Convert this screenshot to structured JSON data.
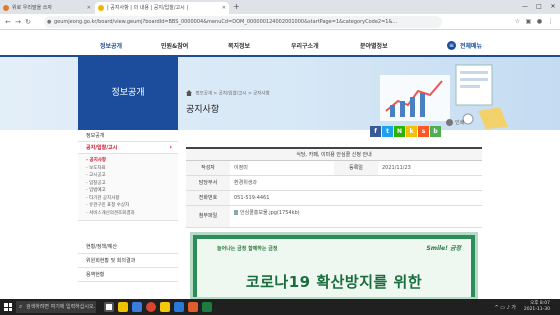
{
  "browser": {
    "tabs": [
      {
        "title": "위로 우리말을 쓰자"
      },
      {
        "title": "| 공지사항 | 의 내용 | 공지/입찰/고시 |"
      }
    ],
    "new_tab": "+",
    "window_controls": [
      "—",
      "□",
      "✕"
    ],
    "url": "geumjeong.go.kr/board/view.geumj?boardId=BBS_0000004&menuCd=DOM_000000124002001000&startPage=1&categoryCode2=1&..."
  },
  "site": {
    "gnb": [
      "정보공개",
      "민원&참여",
      "복지정보",
      "우리구소개",
      "분야별정보"
    ],
    "allmenu_label": "전체메뉴",
    "section_title": "정보공개",
    "breadcrumb": [
      "정보공개",
      "공지/입찰/고시",
      "공지사항"
    ],
    "page_title": "공지사항",
    "print_label": "인쇄"
  },
  "sidebar": {
    "items_top": [
      "정보공개",
      "공지/입찰/고시"
    ],
    "sub_items": [
      "공지사항",
      "보도자료",
      "고시공고",
      "입찰공고",
      "입법예고",
      "타기관 공지사항",
      "유관구민 표창 수상자",
      "서비스개선의견조회결과"
    ],
    "items_bottom": [
      "현황/정책/예산",
      "위원회현황 및 회의결과",
      "용역현황"
    ]
  },
  "post": {
    "title": "식당, 카페, 이미용 안심콜 신청 안내",
    "author_label": "작성자",
    "author": "이정미",
    "date_label": "등록일",
    "date": "2021/11/23",
    "dept_label": "담당부서",
    "dept": "환경위생과",
    "phone_label": "전화번호",
    "phone": "051-519-4461",
    "file_label": "첨부파일",
    "file": "안심콜홍보물.jpg(1754kb)"
  },
  "poster": {
    "logo_left": "늘어나는 금정 함께하는 금정",
    "logo_right": "Smile! 금정",
    "headline": "코로나19 확산방지를 위한"
  },
  "taskbar": {
    "search_placeholder": "검색하려면 여기에 입력하십시오.",
    "time": "오후 8:07",
    "date": "2021-11-30"
  }
}
